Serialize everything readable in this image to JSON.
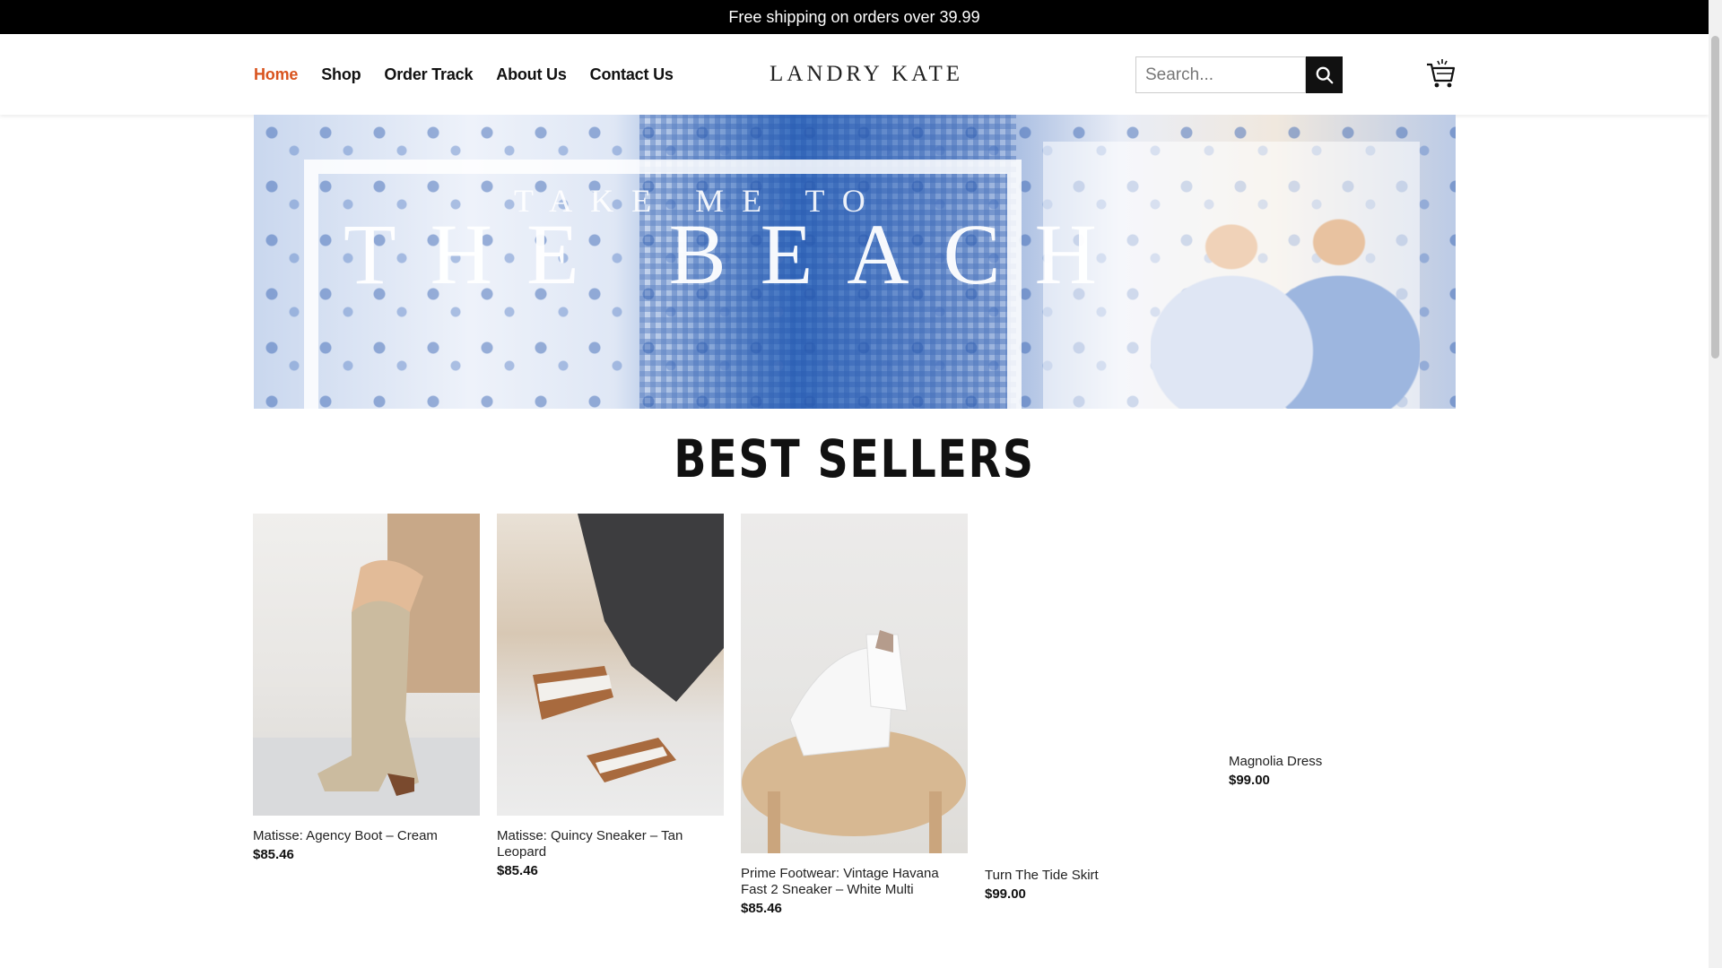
{
  "announcement": "Free shipping on orders over 39.99",
  "nav": {
    "items": [
      "Home",
      "Shop",
      "Order Track",
      "About Us",
      "Contact Us"
    ],
    "active": "Home"
  },
  "logo": "LANDRY KATE",
  "search": {
    "placeholder": "Search..."
  },
  "hero": {
    "line1": "TAKE ME TO",
    "line2": "THE BEACH"
  },
  "best_sellers": {
    "title": "BEST SELLERS",
    "products": [
      {
        "name": "Matisse: Agency Boot – Cream",
        "price": "$85.46"
      },
      {
        "name": "Matisse: Quincy Sneaker – Tan Leopard",
        "price": "$85.46"
      },
      {
        "name": "Prime Footwear: Vintage Havana Fast 2 Sneaker – White Multi",
        "price": "$85.46"
      },
      {
        "name": "Turn The Tide Skirt",
        "price": "$99.00"
      },
      {
        "name": "Magnolia Dress",
        "price": "$99.00"
      }
    ]
  },
  "colors": {
    "accent": "#d9541e",
    "topbar": "#000000"
  },
  "icons": [
    "search-icon",
    "cart-icon"
  ]
}
